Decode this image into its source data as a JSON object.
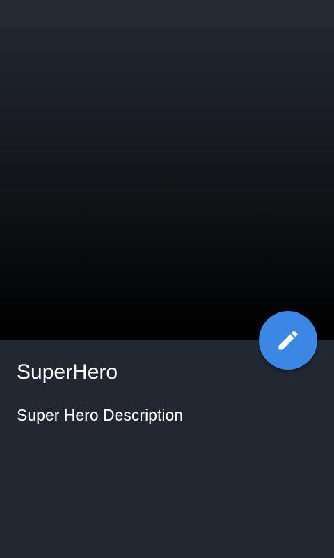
{
  "hero": {
    "name": "SuperHero",
    "description": "Super Hero Description"
  },
  "fab": {
    "icon": "edit-pencil-icon",
    "color": "#3b87e5"
  },
  "colors": {
    "background": "#222831",
    "status_bar": "#252b33",
    "text": "#ffffff"
  }
}
